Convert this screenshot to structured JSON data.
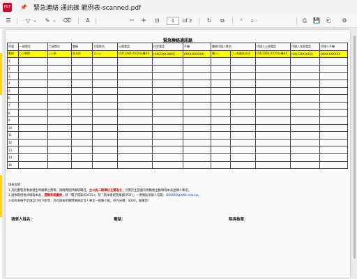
{
  "window": {
    "app_icon_label": "PDF",
    "title": "緊急連絡 通訊錄 範例表-scanned.pdf"
  },
  "toolbar": {
    "page_current": "1",
    "page_total": "of 2"
  },
  "document": {
    "title": "緊急聯絡通訊錄",
    "headers": [
      "序號",
      "一級單位",
      "二級單位",
      "職稱",
      "主管姓名",
      "公務電話",
      "住家電話",
      "手機",
      "職務代理人姓名",
      "代理人公務電話",
      "代理人住家電話",
      "代理人手機"
    ],
    "example_row": [
      "範例",
      "○○學院",
      "○○系",
      "系主任",
      "王○○",
      "(04)2284-XXXX分機XX",
      "(04)23XX-XXXX",
      "09XX-XXXXXX",
      "陳○○",
      "○○系副系主任",
      "(04)2284-XXXX分機XX",
      "(04)23XX-XXXX",
      "09XX-XXXXXX"
    ],
    "row_numbers": [
      "1",
      "2",
      "3",
      "4",
      "5",
      "6",
      "7",
      "8",
      "9",
      "10",
      "11",
      "12",
      "13",
      "14",
      "15"
    ],
    "notes": {
      "heading": "填表說明：",
      "line1_a": "1.為因應緊急事故發生時聯繫之需要，請確實提供聯絡電話，並",
      "line1_red": "以各二級單位主管為主",
      "line1_b": "；另需於主管處有異動應主動填寫本表並轉人事室。",
      "line2_a": "2.請依範例格式填寫本表，",
      "line2_red": "提聯系統彙後",
      "line2_b": "，將「電子檔案(EXCEL)」及「紙本後經簽章檔(PDF)」一併傳送承辦人信箱：",
      "line2_blue": "OOOOO@XXX.edu.tw",
      "line2_c": "。",
      "line3": "3.如有表格不足請自行往下新增，另有填表相關問題請逕洽人事室－組陳小組，校內分機：0000，謝謝您！"
    },
    "signature": {
      "filler_label": "填表人姓名：",
      "phone_label": "電話：",
      "approver_label": "院長核章："
    }
  }
}
